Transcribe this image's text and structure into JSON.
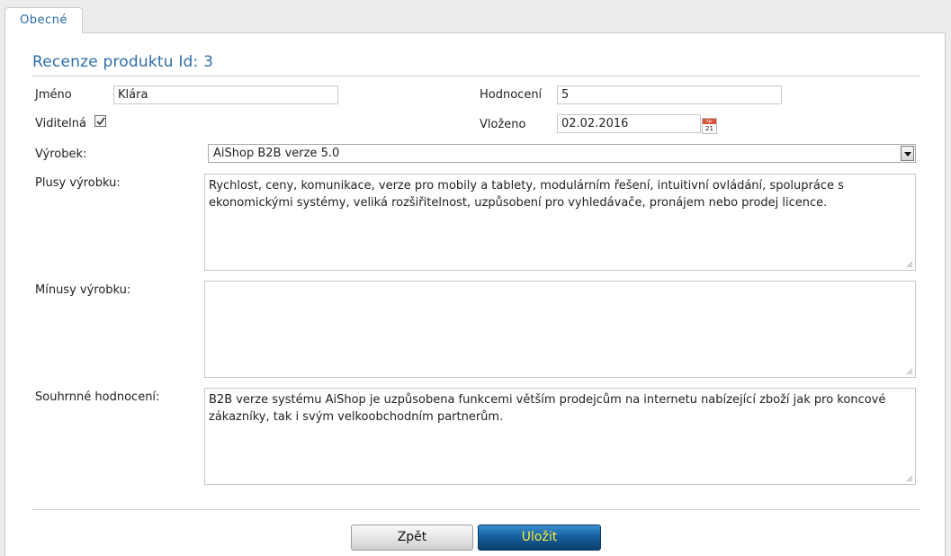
{
  "tabs": [
    {
      "label": "Obecné",
      "active": true
    }
  ],
  "page_title": "Recenze produktu Id: 3",
  "form": {
    "name": {
      "label": "Jméno",
      "value": "Klára"
    },
    "rating": {
      "label": "Hodnocení",
      "value": "5"
    },
    "visible": {
      "label": "Viditelná",
      "checked": true
    },
    "inserted": {
      "label": "Vloženo",
      "value": "02.02.2016",
      "calendar_icon": "calendar-icon",
      "calendar_top": "Apr",
      "calendar_day": "21"
    },
    "product": {
      "label": "Výrobek:",
      "value": "AiShop B2B verze 5.0"
    },
    "pros": {
      "label": "Plusy výrobku:",
      "value": "Rychlost, ceny, komunikace, verze pro mobily a tablety, modulárním řešení, intuitivní ovládání, spolupráce s ekonomickými systémy, veliká rozšiřitelnost, uzpůsobení pro vyhledávače, pronájem nebo prodej licence."
    },
    "cons": {
      "label": "Mínusy výrobku:",
      "value": ""
    },
    "summary": {
      "label": "Souhrnné hodnocení:",
      "value": "B2B verze systému AiShop je uzpůsobena funkcemi větším prodejcům na internetu nabízející zboží jak pro koncové zákazníky, tak i svým velkoobchodním partnerům."
    }
  },
  "buttons": {
    "back": "Zpět",
    "save": "Uložit"
  },
  "colors": {
    "title": "#2d6da8",
    "tab_text": "#2a6aa6",
    "save_bg": "#16609f",
    "save_text": "#ffef3a"
  }
}
